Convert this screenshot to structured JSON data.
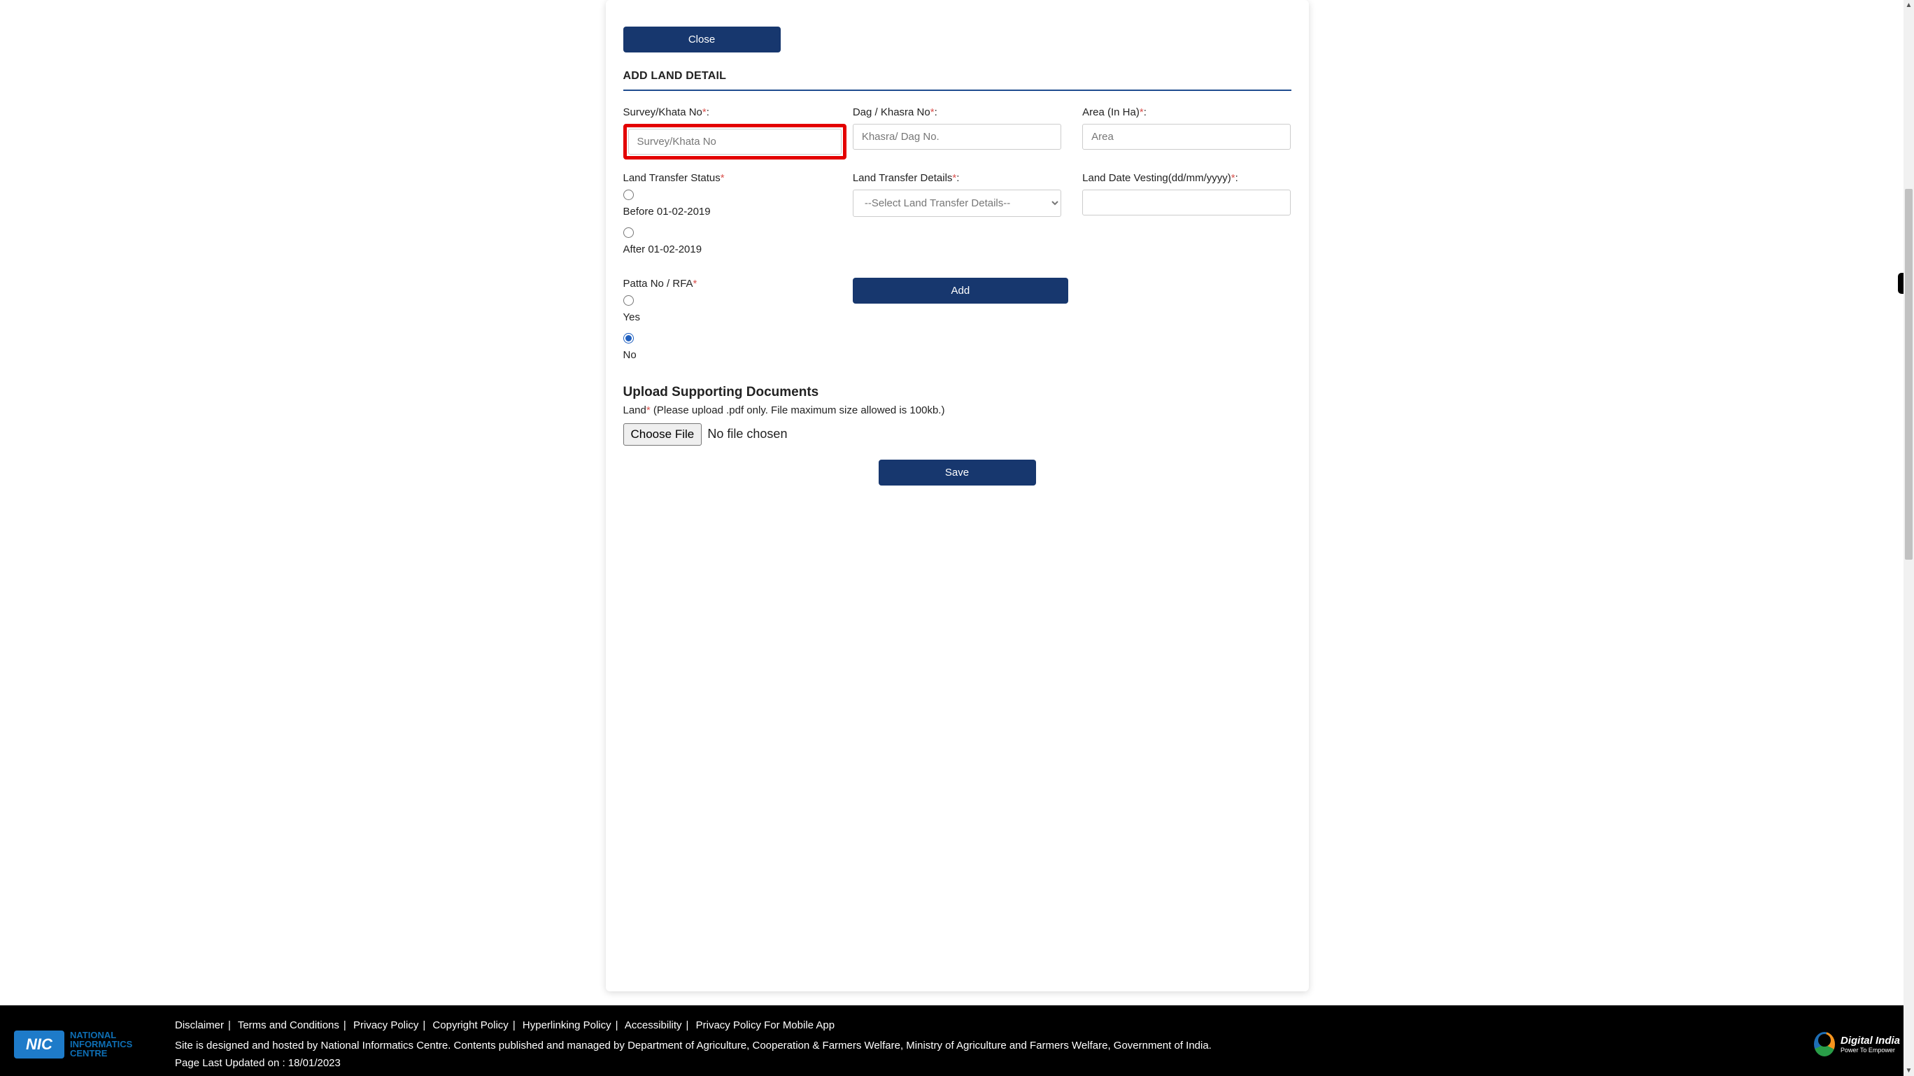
{
  "buttons": {
    "close": "Close",
    "add": "Add",
    "save": "Save",
    "chooseFile": "Choose File",
    "fileStatus": "No file chosen"
  },
  "section": {
    "addLandTitle": "ADD LAND DETAIL",
    "uploadTitle": "Upload Supporting Documents"
  },
  "fields": {
    "surveyLabel": "Survey/Khata No",
    "surveyPlaceholder": "Survey/Khata No",
    "dagLabel": "Dag / Khasra No",
    "dagPlaceholder": "Khasra/ Dag No.",
    "areaLabel": "Area (In Ha)",
    "areaPlaceholder": "Area",
    "transferStatusLabel": "Land Transfer Status",
    "transferStatusOptions": {
      "before": "Before 01-02-2019",
      "after": "After 01-02-2019"
    },
    "transferDetailsLabel": "Land Transfer Details",
    "transferDetailsSelected": "--Select Land Transfer Details--",
    "vestingLabel": "Land Date Vesting(dd/mm/yyyy)",
    "pattaLabel": "Patta No / RFA",
    "pattaOptions": {
      "yes": "Yes",
      "no": "No"
    },
    "landUploadLabel": "Land",
    "landUploadHint": " (Please upload .pdf only. File maximum size allowed is 100kb.)"
  },
  "footer": {
    "links": [
      "Disclaimer",
      "Terms and Conditions",
      "Privacy Policy",
      "Copyright Policy",
      "Hyperlinking Policy",
      "Accessibility",
      "Privacy Policy For Mobile App"
    ],
    "line1": "Site is designed and hosted by National Informatics Centre. Contents published and managed by Department of Agriculture, Cooperation & Farmers Welfare, Ministry of Agriculture and Farmers Welfare, Government of India.",
    "updatedPrefix": "Page Last Updated on : ",
    "updatedDate": "18/01/2023",
    "nic": {
      "badge": "NIC",
      "line1": "NATIONAL",
      "line2": "INFORMATICS",
      "line3": "CENTRE"
    },
    "digitalIndia": {
      "title": "Digital India",
      "sub": "Power To Empower"
    }
  }
}
